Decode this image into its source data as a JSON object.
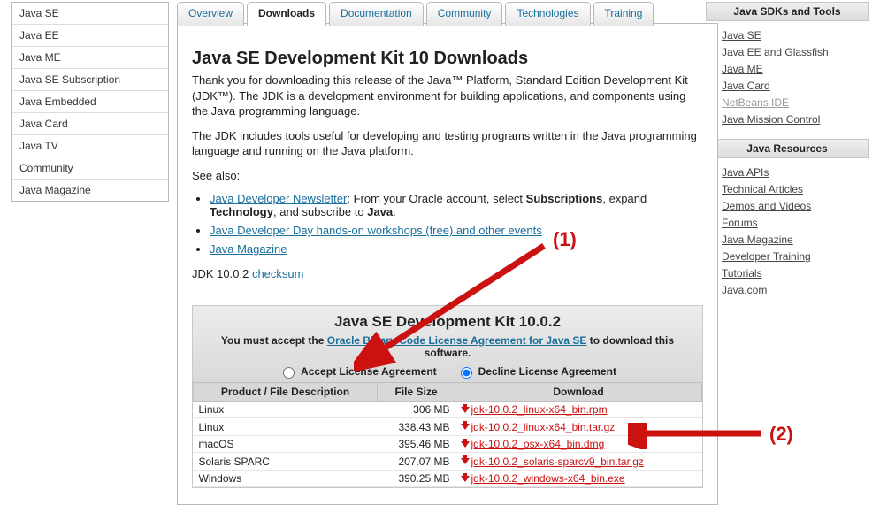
{
  "leftnav": {
    "items": [
      "Java SE",
      "Java EE",
      "Java ME",
      "Java SE Subscription",
      "Java Embedded",
      "Java Card",
      "Java TV",
      "Community",
      "Java Magazine"
    ]
  },
  "tabs": {
    "items": [
      "Overview",
      "Downloads",
      "Documentation",
      "Community",
      "Technologies",
      "Training"
    ],
    "active_index": 1
  },
  "main": {
    "title": "Java SE Development Kit 10 Downloads",
    "intro1": "Thank you for downloading this release of the Java™ Platform, Standard Edition Development Kit (JDK™). The JDK is a development environment for building applications, and components using the Java programming language.",
    "intro2": "The JDK includes tools useful for developing and testing programs written in the Java programming language and running on the Java platform.",
    "see_also_label": "See also:",
    "see_also": [
      {
        "link": "Java Developer Newsletter",
        "text_after": ": From your Oracle account, select ",
        "bold1": "Subscriptions",
        "mid": ", expand ",
        "bold2": "Technology",
        "mid2": ", and subscribe to ",
        "bold3": "Java",
        "end": "."
      },
      {
        "link": "Java Developer Day hands-on workshops (free) and other events"
      },
      {
        "link": "Java Magazine"
      }
    ],
    "jdk_line_prefix": "JDK 10.0.2 ",
    "jdk_checksum": "checksum"
  },
  "dl": {
    "title": "Java SE Development Kit 10.0.2",
    "must_pre": "You must accept the ",
    "must_link": "Oracle Binary Code License Agreement for Java SE",
    "must_post": " to download this software.",
    "accept": "Accept License Agreement",
    "decline": "Decline License Agreement",
    "cols": [
      "Product / File Description",
      "File Size",
      "Download"
    ],
    "rows": [
      {
        "desc": "Linux",
        "size": "306 MB",
        "file": "jdk-10.0.2_linux-x64_bin.rpm"
      },
      {
        "desc": "Linux",
        "size": "338.43 MB",
        "file": "jdk-10.0.2_linux-x64_bin.tar.gz"
      },
      {
        "desc": "macOS",
        "size": "395.46 MB",
        "file": "jdk-10.0.2_osx-x64_bin.dmg"
      },
      {
        "desc": "Solaris SPARC",
        "size": "207.07 MB",
        "file": "jdk-10.0.2_solaris-sparcv9_bin.tar.gz"
      },
      {
        "desc": "Windows",
        "size": "390.25 MB",
        "file": "jdk-10.0.2_windows-x64_bin.exe"
      }
    ]
  },
  "right": {
    "head1": "Java SDKs and Tools",
    "links1": [
      {
        "label": "Java SE"
      },
      {
        "label": "Java EE and Glassfish"
      },
      {
        "label": "Java ME"
      },
      {
        "label": "Java Card"
      },
      {
        "label": "NetBeans IDE",
        "disabled": true
      },
      {
        "label": "Java Mission Control"
      }
    ],
    "head2": "Java Resources",
    "links2": [
      {
        "label": "Java APIs"
      },
      {
        "label": "Technical Articles"
      },
      {
        "label": "Demos and Videos"
      },
      {
        "label": "Forums"
      },
      {
        "label": "Java Magazine"
      },
      {
        "label": "Developer Training"
      },
      {
        "label": "Tutorials"
      },
      {
        "label": "Java.com"
      }
    ]
  },
  "annotations": {
    "one": "(1)",
    "two": "(2)"
  }
}
